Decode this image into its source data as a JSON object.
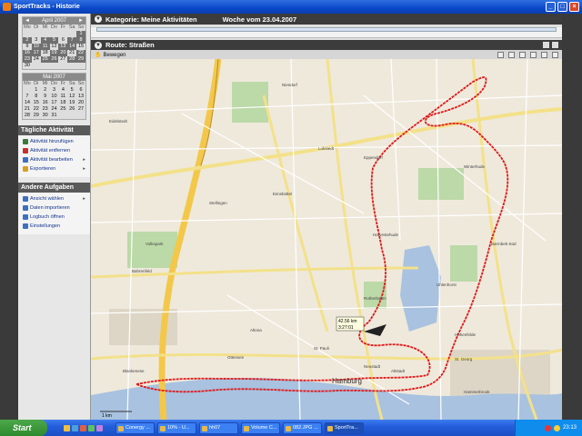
{
  "window": {
    "title": "SportTracks - Historie"
  },
  "calendar_april": {
    "month": "April 2007",
    "days_header": [
      "Mo",
      "Di",
      "Mi",
      "Do",
      "Fr",
      "Sa",
      "So"
    ],
    "rows": [
      [
        "",
        "",
        "",
        "",
        "",
        "",
        "1"
      ],
      [
        "2",
        "3",
        "4",
        "5",
        "6",
        "7",
        "8"
      ],
      [
        "9",
        "10",
        "11",
        "12",
        "13",
        "14",
        "15"
      ],
      [
        "16",
        "17",
        "18",
        "19",
        "20",
        "21",
        "22"
      ],
      [
        "23",
        "24",
        "25",
        "26",
        "27",
        "28",
        "29"
      ],
      [
        "30",
        "",
        "",
        "",
        "",
        "",
        ""
      ]
    ]
  },
  "calendar_may": {
    "month": "Mai 2007",
    "days_header": [
      "Mo",
      "Di",
      "Mi",
      "Do",
      "Fr",
      "Sa",
      "So"
    ],
    "rows": [
      [
        "",
        "1",
        "2",
        "3",
        "4",
        "5",
        "6"
      ],
      [
        "7",
        "8",
        "9",
        "10",
        "11",
        "12",
        "13"
      ],
      [
        "14",
        "15",
        "16",
        "17",
        "18",
        "19",
        "20"
      ],
      [
        "21",
        "22",
        "23",
        "24",
        "25",
        "26",
        "27"
      ],
      [
        "28",
        "29",
        "30",
        "31",
        "",
        "",
        ""
      ]
    ]
  },
  "daily": {
    "title": "Tägliche Aktivität",
    "items": [
      {
        "label": "Aktivität hinzufügen",
        "icon": "add-icon",
        "color": "#3a7a3a"
      },
      {
        "label": "Aktivität entfernen",
        "icon": "delete-icon",
        "color": "#c43030"
      },
      {
        "label": "Aktivität bearbeiten",
        "icon": "edit-icon",
        "color": "#3f6fc0"
      },
      {
        "label": "Exportieren",
        "icon": "export-icon",
        "color": "#d8a020"
      }
    ]
  },
  "other": {
    "title": "Andere Aufgaben",
    "items": [
      {
        "label": "Ansicht wählen",
        "icon": "view-icon",
        "color": "#3f6fc0"
      },
      {
        "label": "Daten importieren",
        "icon": "import-icon",
        "color": "#3f6fc0"
      },
      {
        "label": "Logbuch öffnen",
        "icon": "logbook-icon",
        "color": "#3f6fc0"
      },
      {
        "label": "Einstellungen",
        "icon": "settings-icon",
        "color": "#3f6fc0"
      }
    ]
  },
  "main": {
    "category": "Kategorie: Meine Aktivitäten",
    "week": "Woche vom 23.04.2007",
    "route": "Route: Straßen",
    "tool_move": "Bewegen"
  },
  "map": {
    "city": "Hamburg",
    "labels": [
      "Eidelstedt",
      "Niendorf",
      "Lokstedt",
      "Eppendorf",
      "Barmbek-Süd",
      "Altona",
      "St. Pauli",
      "Hohenfelde",
      "Ottensen",
      "Blankenese",
      "Bahrenfeld",
      "Eimsbüttel",
      "Winterhude",
      "Uhlenhorst",
      "Stellingen",
      "Volkspark",
      "Rotherbaum",
      "Harvestehude",
      "St. Georg",
      "Hammerbrook",
      "Neustadt",
      "Altstadt"
    ],
    "marker_distance": "42.56 km",
    "marker_time": "3:27:01",
    "scale": "1 km",
    "route_color": "#e01818"
  },
  "taskbar": {
    "start": "Start",
    "tasks": [
      "Conergy ...",
      "10% - U...",
      "hh07",
      "Volume C...",
      "082.JPG ...",
      "SportTra..."
    ],
    "clock": "23:13"
  }
}
